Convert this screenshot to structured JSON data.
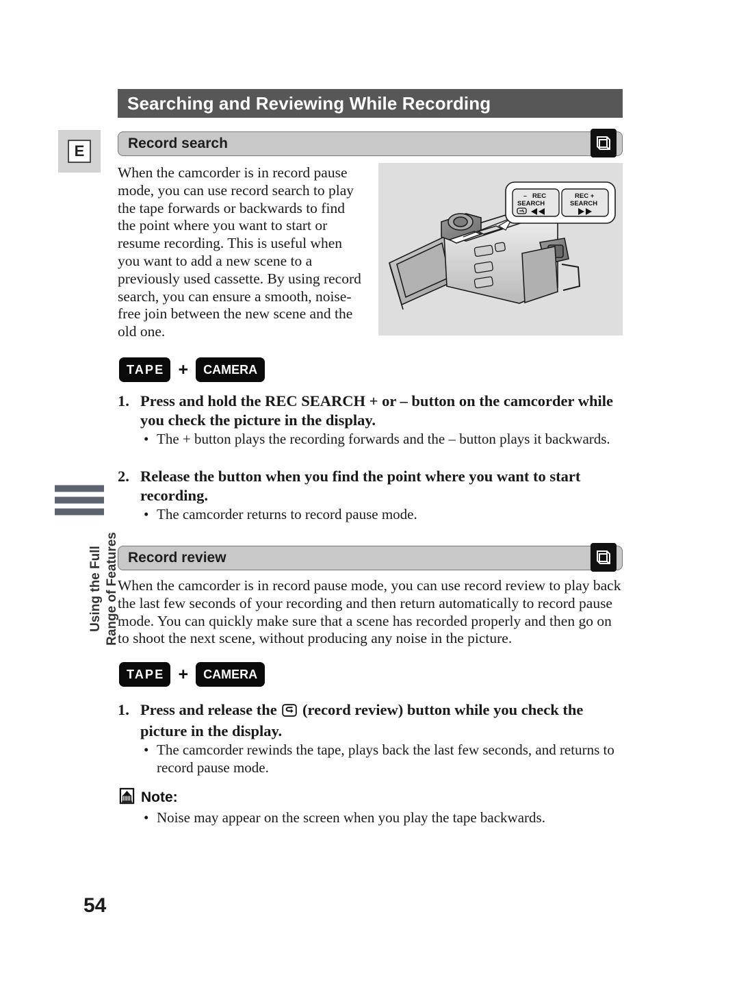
{
  "page": {
    "language_tab": "E",
    "page_number": "54",
    "running_head_line1": "Using the Full",
    "running_head_line2": "Range of Features",
    "title": "Searching and Reviewing While Recording"
  },
  "sections": [
    {
      "id": "record-search",
      "heading": "Record search",
      "icon": "tape-cassette-icon",
      "intro": "When the camcorder is in record pause mode, you can use record search to play the tape forwards or backwards to find the point where you want to start or resume recording. This is useful when you want to add a new scene to a previously used cassette. By using record search, you can ensure a smooth, noise-free join between the new scene and the old one.",
      "badges": {
        "first": "TAPE",
        "operator": "+",
        "second": "CAMERA"
      },
      "steps": [
        {
          "number": "1.",
          "text": "Press and hold the REC SEARCH + or – button on the camcorder while you check the picture in the display.",
          "bullets": [
            "The + button plays the recording forwards and the – button plays it backwards."
          ]
        },
        {
          "number": "2.",
          "text": "Release the button when you find the point where you want to start recording.",
          "bullets": [
            "The camcorder returns to record pause mode."
          ]
        }
      ]
    },
    {
      "id": "record-review",
      "heading": "Record review",
      "icon": "tape-cassette-icon",
      "intro": "When the camcorder is in record pause mode, you can use record review to play back the last few seconds of your recording and then return automatically to record pause mode. You can quickly make sure that a scene has recorded properly and then go on to shoot the next scene, without producing any noise in the picture.",
      "badges": {
        "first": "TAPE",
        "operator": "+",
        "second": "CAMERA"
      },
      "steps": [
        {
          "number": "1.",
          "text_before_icon": "Press and release the",
          "inline_icon": "record-review-icon",
          "text_after_icon": "(record review) button while you check the picture in the display.",
          "bullets": [
            "The camcorder rewinds the tape, plays back the last few seconds, and returns to record pause mode."
          ]
        }
      ]
    }
  ],
  "note": {
    "icon": "note-bell-icon",
    "label": "Note:",
    "bullets": [
      "Noise may appear on the screen when you play the tape backwards."
    ]
  },
  "illustration": {
    "alt": "camcorder-with-rec-search-callout",
    "callout": {
      "minus_button": {
        "sign": "–",
        "line1": "REC",
        "line2": "SEARCH",
        "icon": "record-review-icon",
        "transport": "◀◀"
      },
      "plus_button": {
        "line1": "REC +",
        "line2": "SEARCH",
        "transport": "▶▶"
      }
    }
  },
  "colors": {
    "title_bar": "#575757",
    "section_bar": "#c8c8c8",
    "badge": "#0a0a0a",
    "illustration_bg": "#dedede",
    "side_bar": "#5c6270"
  }
}
